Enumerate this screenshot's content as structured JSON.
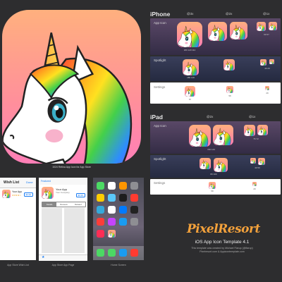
{
  "big_icon_caption": "1024 Retina App Icon for App Store",
  "iphone": {
    "title": "iPhone",
    "scales": [
      "@3x",
      "@2x",
      "@1x"
    ],
    "rows": {
      "app_icon": "App Icon",
      "spotlight": "Spotlight",
      "settings": "Settings"
    },
    "sizes": {
      "app": [
        "180 120 114",
        "",
        "60 57"
      ],
      "spotlight": [
        "180 120",
        "",
        "40 29"
      ],
      "settings": [
        "87",
        "58",
        "29"
      ]
    }
  },
  "ipad": {
    "title": "iPad",
    "scales": [
      "@2x",
      "@1x"
    ],
    "rows": {
      "app_icon": "App Icon",
      "spotlight": "Spotlight",
      "settings": "Settings"
    },
    "sizes": {
      "app": [
        "152 144",
        "76 72"
      ],
      "spotlight": [
        "80 100",
        "40 50"
      ],
      "settings": [
        "58",
        "29"
      ]
    }
  },
  "screens": {
    "wishlist": {
      "caption": "App Store Wish List",
      "header": "Wish List",
      "done": "Done",
      "app_name": "Your App",
      "price": "$0.99"
    },
    "appstore": {
      "caption": "App Store App Page",
      "back": "Featured",
      "app_name": "Your App",
      "company": "Your Company",
      "price": "$0.99",
      "tabs": [
        "Details",
        "Reviews",
        "Related"
      ]
    },
    "home": {
      "caption": "Home Screen"
    }
  },
  "branding": {
    "logo": "PixelResort",
    "template": "iOS App Icon Template 4.1",
    "credit_lines": [
      "This template was created by Michael Flarup (@flarup)",
      "Pixelresort.com & Appicontemplate.com"
    ]
  },
  "colors": {
    "accent_orange": "#f3a13b",
    "icon_top": "#ffb07e",
    "icon_bottom": "#ff7fb7"
  },
  "icons": [
    "unicorn-icon",
    "app-icon-thumbnail"
  ]
}
